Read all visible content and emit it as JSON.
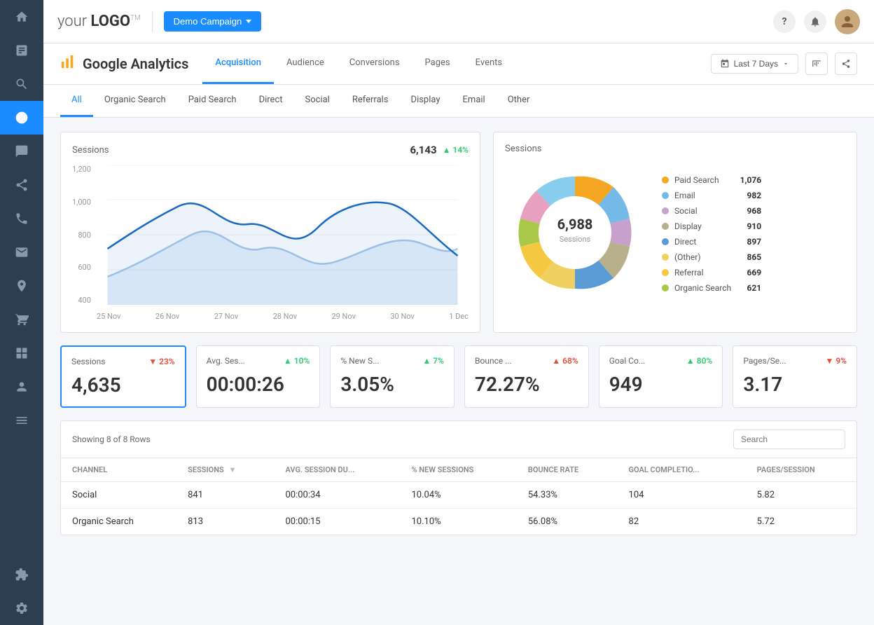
{
  "topbar": {
    "logo": "your LOGO",
    "logo_tm": "TM",
    "campaign_btn": "Demo Campaign",
    "help_icon": "?",
    "notification_icon": "🔔"
  },
  "page": {
    "title": "Google Analytics",
    "icon": "📊",
    "tabs": [
      {
        "label": "Acquisition",
        "active": true
      },
      {
        "label": "Audience",
        "active": false
      },
      {
        "label": "Conversions",
        "active": false
      },
      {
        "label": "Pages",
        "active": false
      },
      {
        "label": "Events",
        "active": false
      }
    ],
    "date_btn": "Last 7 Days"
  },
  "sub_tabs": [
    "All",
    "Organic Search",
    "Paid Search",
    "Direct",
    "Social",
    "Referrals",
    "Display",
    "Email",
    "Other"
  ],
  "line_chart": {
    "title": "Sessions",
    "value": "6,143",
    "badge": "▲ 14%",
    "badge_type": "up",
    "y_labels": [
      "1,200",
      "1,000",
      "800",
      "600",
      "400"
    ],
    "x_labels": [
      "25 Nov",
      "26 Nov",
      "27 Nov",
      "28 Nov",
      "29 Nov",
      "30 Nov",
      "1 Dec"
    ]
  },
  "donut_chart": {
    "title": "Sessions",
    "center_value": "6,988",
    "center_label": "Sessions",
    "legend": [
      {
        "label": "Paid Search",
        "value": "1,076",
        "color": "#f5a623"
      },
      {
        "label": "Email",
        "value": "982",
        "color": "#74b9e8"
      },
      {
        "label": "Social",
        "value": "968",
        "color": "#c7a0cc"
      },
      {
        "label": "Display",
        "value": "910",
        "color": "#b8b08c"
      },
      {
        "label": "Direct",
        "value": "897",
        "color": "#5b9bd5"
      },
      {
        "label": "(Other)",
        "value": "865",
        "color": "#f0d060"
      },
      {
        "label": "Referral",
        "value": "669",
        "color": "#f5c842"
      },
      {
        "label": "Organic Search",
        "value": "621",
        "color": "#a8c84a"
      }
    ]
  },
  "metrics": [
    {
      "title": "Sessions",
      "value": "4,635",
      "badge": "▼ 23%",
      "badge_type": "down",
      "selected": true
    },
    {
      "title": "Avg. Ses...",
      "value": "00:00:26",
      "badge": "▲ 10%",
      "badge_type": "up",
      "selected": false
    },
    {
      "title": "% New S...",
      "value": "3.05%",
      "badge": "▲ 7%",
      "badge_type": "up",
      "selected": false
    },
    {
      "title": "Bounce ...",
      "value": "72.27%",
      "badge": "▲ 68%",
      "badge_type": "down",
      "selected": false
    },
    {
      "title": "Goal Co...",
      "value": "949",
      "badge": "▲ 80%",
      "badge_type": "up",
      "selected": false
    },
    {
      "title": "Pages/Se...",
      "value": "3.17",
      "badge": "▼ 9%",
      "badge_type": "down",
      "selected": false
    }
  ],
  "table": {
    "info": "Showing 8 of 8 Rows",
    "search_placeholder": "Search",
    "columns": [
      "CHANNEL",
      "SESSIONS",
      "AVG. SESSION DU...",
      "% NEW SESSIONS",
      "BOUNCE RATE",
      "GOAL COMPLETIO...",
      "PAGES/SESSION"
    ],
    "rows": [
      {
        "channel": "Social",
        "sessions": "841",
        "avg_session": "00:00:34",
        "pct_new": "10.04%",
        "bounce": "54.33%",
        "goal": "104",
        "pages": "5.82"
      },
      {
        "channel": "Organic Search",
        "sessions": "813",
        "avg_session": "00:00:15",
        "pct_new": "10.10%",
        "bounce": "56.08%",
        "goal": "82",
        "pages": "5.72"
      }
    ]
  }
}
